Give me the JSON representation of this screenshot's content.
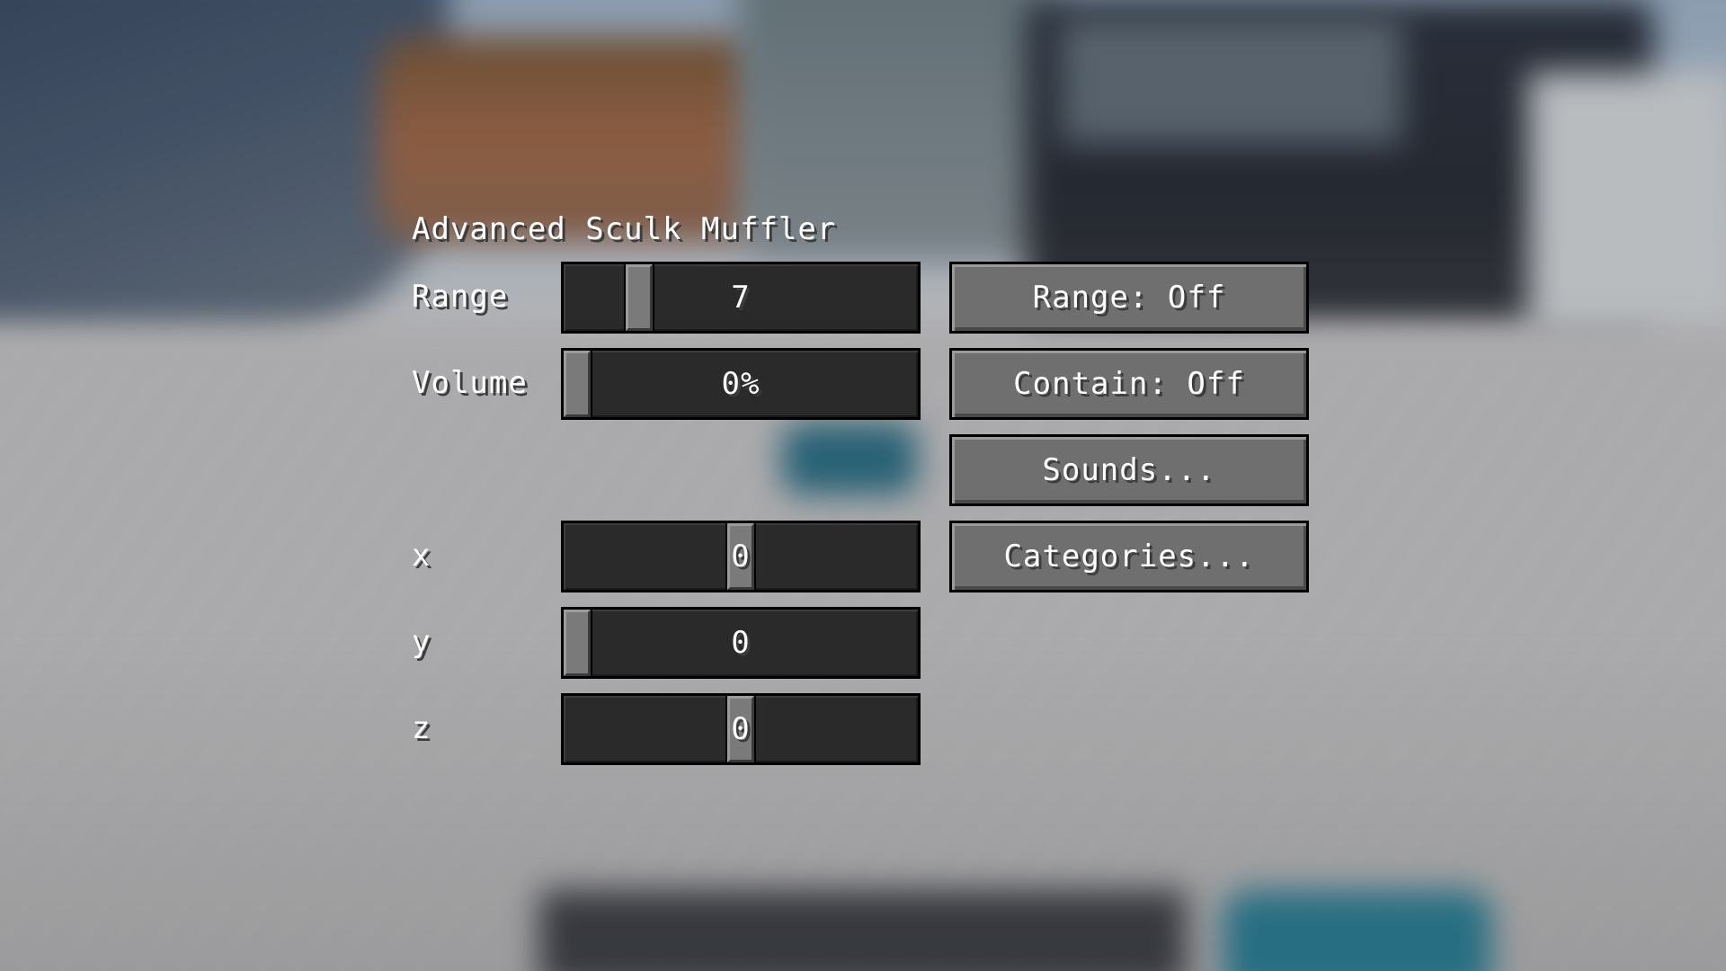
{
  "screen": {
    "title": "Advanced Sculk Muffler"
  },
  "sliders": [
    {
      "id": "range",
      "label": "Range",
      "value_text": "7",
      "level": 0.19
    },
    {
      "id": "volume",
      "label": "Volume",
      "value_text": "0%",
      "level": 0.0
    },
    {
      "id": "x",
      "label": "x",
      "value_text": "0",
      "level": 0.5
    },
    {
      "id": "y",
      "label": "y",
      "value_text": "0",
      "level": 0.0
    },
    {
      "id": "z",
      "label": "z",
      "value_text": "0",
      "level": 0.5
    }
  ],
  "buttons": {
    "range_toggle": "Range: Off",
    "contain_toggle": "Contain: Off",
    "sounds": "Sounds...",
    "categories": "Categories..."
  }
}
